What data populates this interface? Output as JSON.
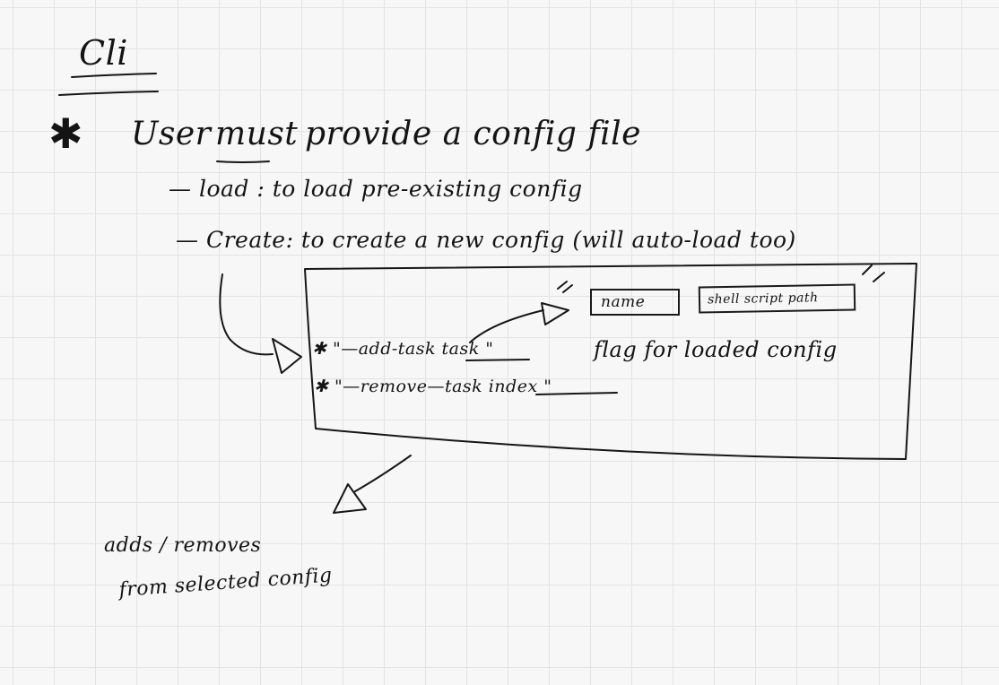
{
  "diagram": {
    "title": "Cli",
    "requirement": {
      "marker": "✱",
      "prefix": "User",
      "emphasis": "must",
      "suffix": "provide a config file"
    },
    "commands": [
      {
        "text": "— load : to load pre-existing config"
      },
      {
        "text": "— Create: to create a new config (will auto-load too)"
      }
    ],
    "flags": {
      "add_task": "✱ \"—add-task task \"",
      "remove_task": "✱ \"—remove—task index \"",
      "task_fields": [
        "name",
        "shell script path"
      ],
      "note": "flag for loaded config"
    },
    "effect": {
      "line1": "adds / removes",
      "line2": "from selected config"
    }
  },
  "colors": {
    "ink": "#141414",
    "grid": "#e3e3e3",
    "paper": "#f7f7f7"
  }
}
